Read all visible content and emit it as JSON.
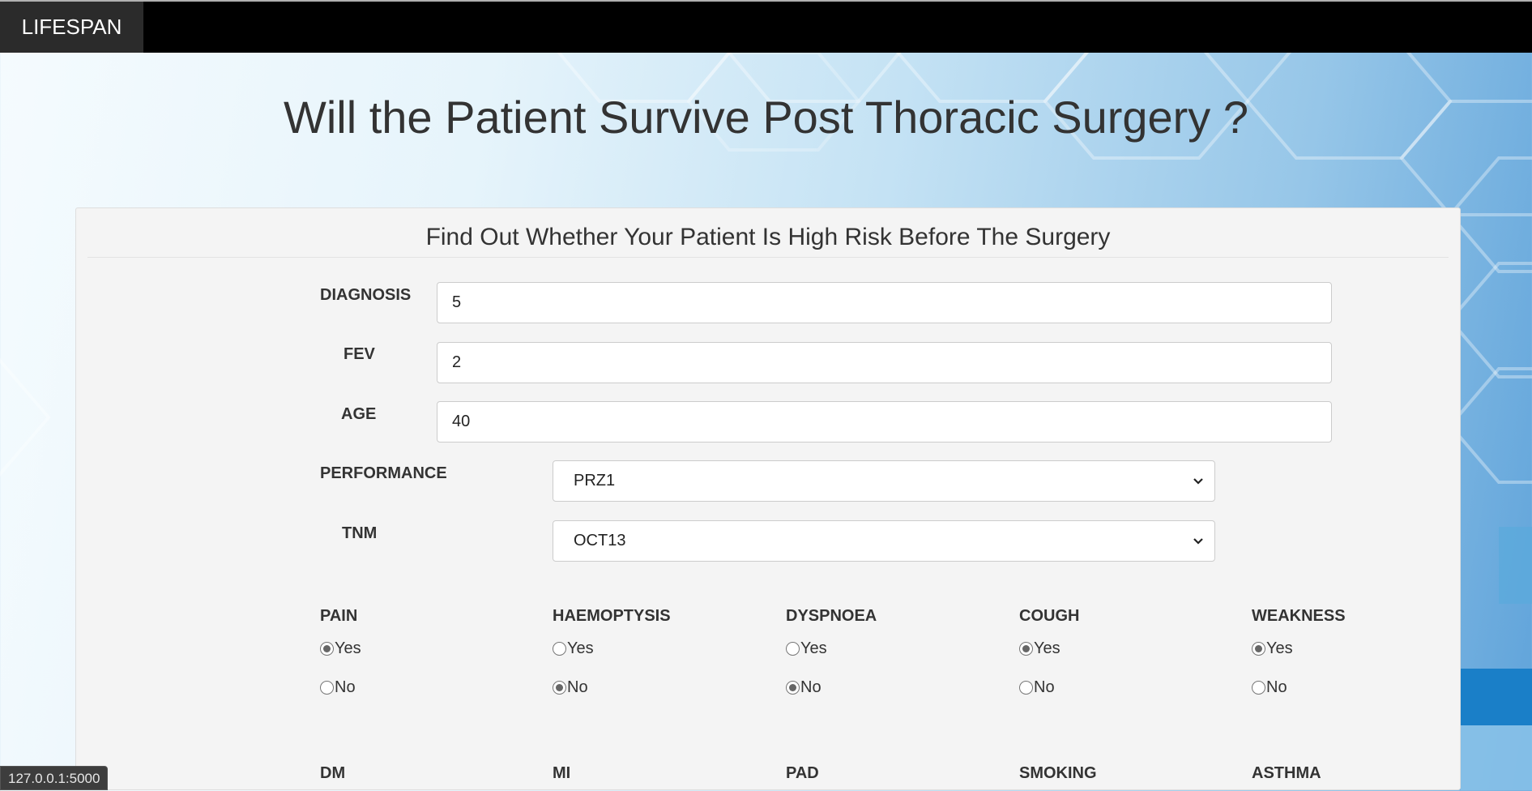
{
  "navbar": {
    "brand": "LIFESPAN"
  },
  "page": {
    "title": "Will the Patient Survive Post Thoracic Surgery ?"
  },
  "form": {
    "heading": "Find Out Whether Your Patient Is High Risk Before The Surgery",
    "diagnosis": {
      "label": "DIAGNOSIS",
      "value": "5"
    },
    "fev": {
      "label": "FEV",
      "value": "2"
    },
    "age": {
      "label": "AGE",
      "value": "40"
    },
    "performance": {
      "label": "PERFORMANCE",
      "selected": "PRZ1"
    },
    "tnm": {
      "label": "TNM",
      "selected": "OCT13"
    },
    "symptoms": [
      {
        "name": "PAIN",
        "yes": "Yes",
        "no": "No",
        "checked": "yes"
      },
      {
        "name": "HAEMOPTYSIS",
        "yes": "Yes",
        "no": "No",
        "checked": "no"
      },
      {
        "name": "DYSPNOEA",
        "yes": "Yes",
        "no": "No",
        "checked": "no"
      },
      {
        "name": "COUGH",
        "yes": "Yes",
        "no": "No",
        "checked": "yes"
      },
      {
        "name": "WEAKNESS",
        "yes": "Yes",
        "no": "No",
        "checked": "yes"
      }
    ],
    "conditions": [
      "DM",
      "MI",
      "PAD",
      "SMOKING",
      "ASTHMA"
    ]
  },
  "status_bar": {
    "url": "127.0.0.1:5000"
  }
}
